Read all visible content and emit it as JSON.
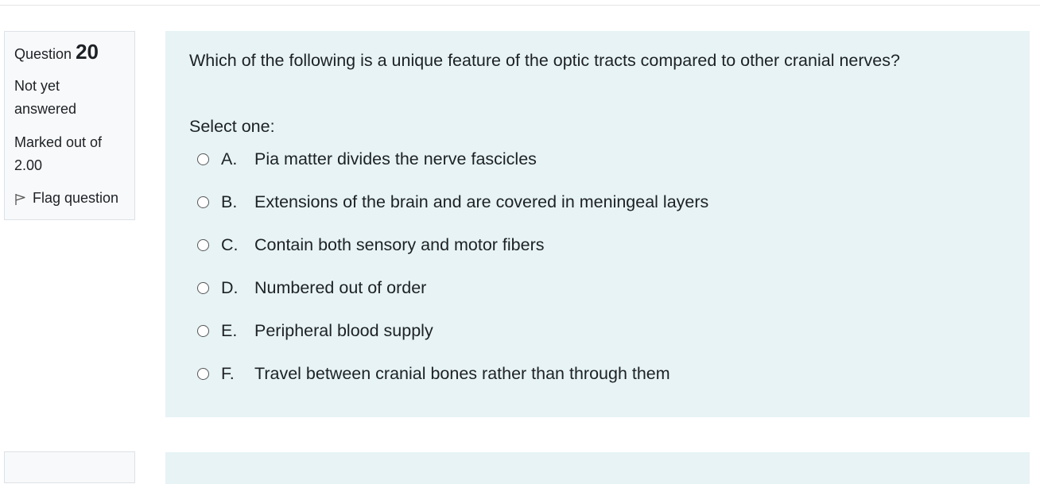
{
  "question": {
    "label": "Question",
    "number": "20",
    "state": "Not yet answered",
    "grade": "Marked out of 2.00",
    "flag_label": "Flag question",
    "text": "Which of the following is a unique feature of the optic tracts compared to other cranial nerves?",
    "prompt": "Select one:",
    "options": [
      {
        "letter": "A.",
        "text": "Pia matter divides the nerve fascicles"
      },
      {
        "letter": "B.",
        "text": "Extensions of the brain and are covered in meningeal layers"
      },
      {
        "letter": "C.",
        "text": "Contain both sensory and motor fibers"
      },
      {
        "letter": "D.",
        "text": "Numbered out of order"
      },
      {
        "letter": "E.",
        "text": "Peripheral blood supply"
      },
      {
        "letter": "F.",
        "text": "Travel between cranial bones rather than through them"
      }
    ]
  },
  "colors": {
    "content_bg": "#e7f3f5",
    "info_bg": "#f8f9fa",
    "text": "#1d2125"
  }
}
